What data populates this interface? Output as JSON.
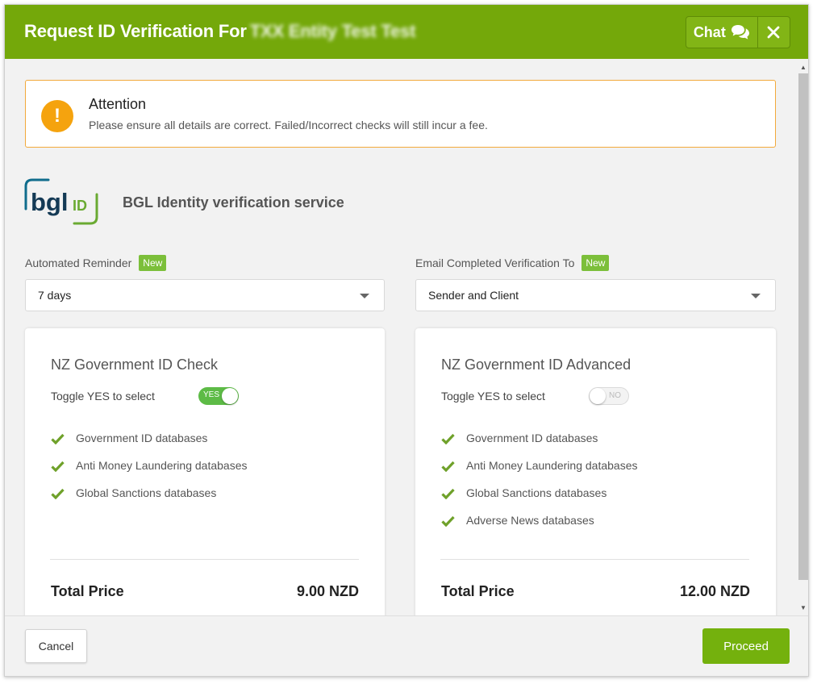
{
  "header": {
    "title": "Request ID Verification For",
    "title_redacted": "TXX Entity Test Test",
    "chat_label": "Chat",
    "chat_icon": "chat-bubbles-icon",
    "close_icon": "close-icon",
    "color": "#74a80a"
  },
  "attention": {
    "title": "Attention",
    "message": "Please ensure all details are correct. Failed/Incorrect checks will still incur a fee.",
    "icon": "exclamation-icon",
    "icon_glyph": "!"
  },
  "service": {
    "logo_text_main": "bgl",
    "logo_text_sub": "ID",
    "name": "BGL Identity verification service"
  },
  "reminder": {
    "label": "Automated Reminder",
    "badge": "New",
    "value": "7 days"
  },
  "email_to": {
    "label": "Email Completed Verification To",
    "badge": "New",
    "value": "Sender and Client"
  },
  "cards": [
    {
      "title": "NZ Government ID Check",
      "toggle_label": "Toggle YES to select",
      "toggle_state": "YES",
      "features": [
        "Government ID databases",
        "Anti Money Laundering databases",
        "Global Sanctions databases"
      ],
      "total_label": "Total Price",
      "total_price": "9.00 NZD"
    },
    {
      "title": "NZ Government ID Advanced",
      "toggle_label": "Toggle YES to select",
      "toggle_state": "NO",
      "features": [
        "Government ID databases",
        "Anti Money Laundering databases",
        "Global Sanctions databases",
        "Adverse News databases"
      ],
      "total_label": "Total Price",
      "total_price": "12.00 NZD"
    }
  ],
  "footer": {
    "cancel_label": "Cancel",
    "proceed_label": "Proceed"
  },
  "colors": {
    "accent": "#74a80a",
    "badge": "#7cbf3a",
    "warning": "#f5a30e",
    "check": "#6fa12a",
    "toggle_on": "#5dbb46"
  }
}
